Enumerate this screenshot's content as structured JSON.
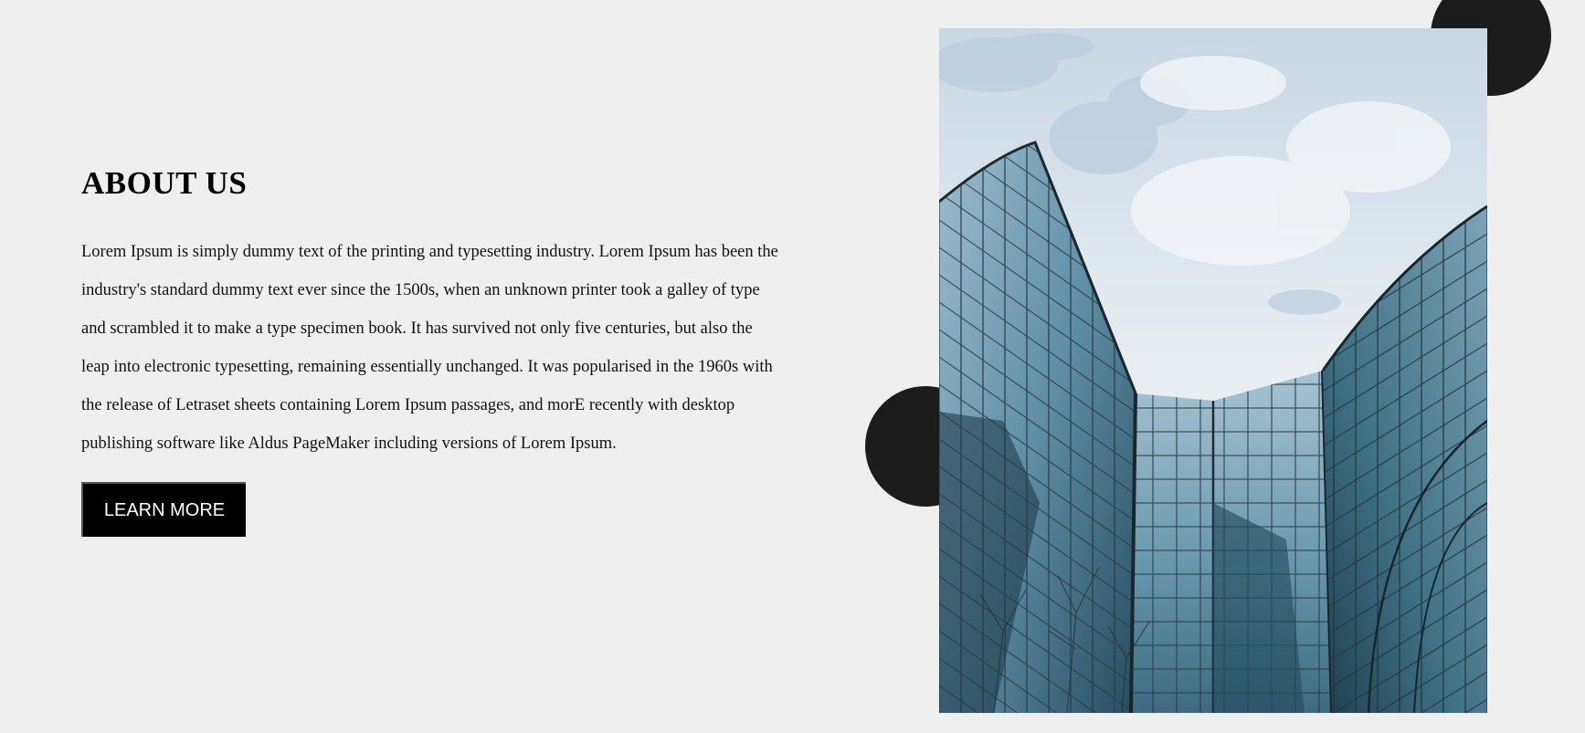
{
  "about": {
    "title": "ABOUT US",
    "body": "Lorem Ipsum is simply dummy text of the printing and typesetting industry. Lorem Ipsum has been the industry's standard dummy text ever since the 1500s, when an unknown printer took a galley of type and scrambled it to make a type specimen book. It has survived not only five centuries, but also the leap into electronic typesetting, remaining essentially unchanged. It was popularised in the 1960s with the release of Letraset sheets containing Lorem Ipsum passages, and morE recently with desktop publishing software like Aldus PageMaker including versions of Lorem Ipsum.",
    "button_label": "LEARN MORE"
  },
  "colors": {
    "background": "#efefef",
    "circle": "#1c1c1c",
    "button": "#000000",
    "text": "#111111"
  },
  "image": {
    "subject": "glass office building from below against a cloudy sky"
  }
}
